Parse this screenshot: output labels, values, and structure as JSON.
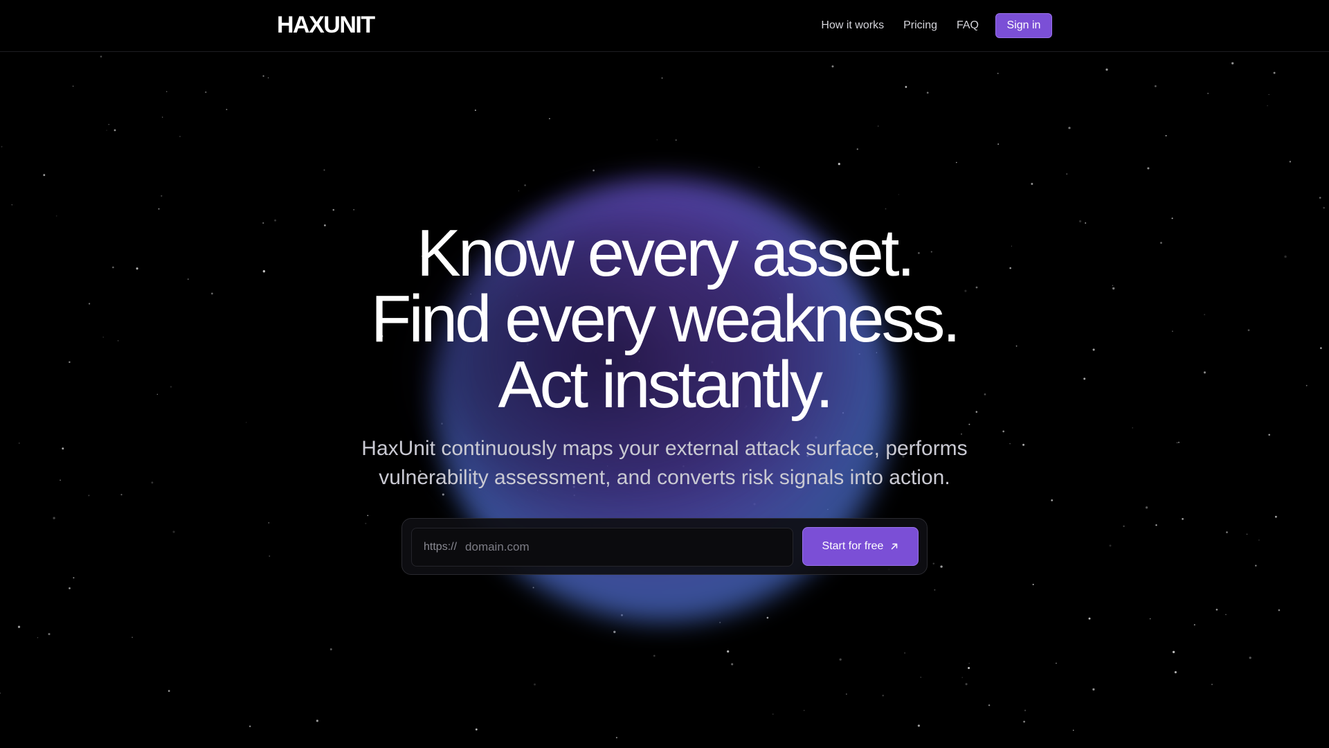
{
  "brand": {
    "logo": "HAXUNIT"
  },
  "nav": {
    "items": [
      {
        "label": "How it works"
      },
      {
        "label": "Pricing"
      },
      {
        "label": "FAQ"
      }
    ],
    "signin_label": "Sign in"
  },
  "hero": {
    "headline_lines": [
      "Know every asset.",
      "Find every weakness.",
      "Act instantly."
    ],
    "subtitle_lines": [
      "HaxUnit continuously maps your external attack surface, performs",
      "vulnerability assessment, and converts risk signals into action."
    ]
  },
  "form": {
    "url_prefix": "https://",
    "placeholder": "domain.com",
    "value": "",
    "submit_label": "Start for free",
    "submit_icon": "arrow-up-right-icon"
  },
  "colors": {
    "background": "#000000",
    "accent": "#7b4fd6",
    "accent_border": "#9a72ea",
    "text_muted": "#c9c9d2",
    "orb_purple": "#784cc8",
    "orb_blue": "#486cc8"
  }
}
